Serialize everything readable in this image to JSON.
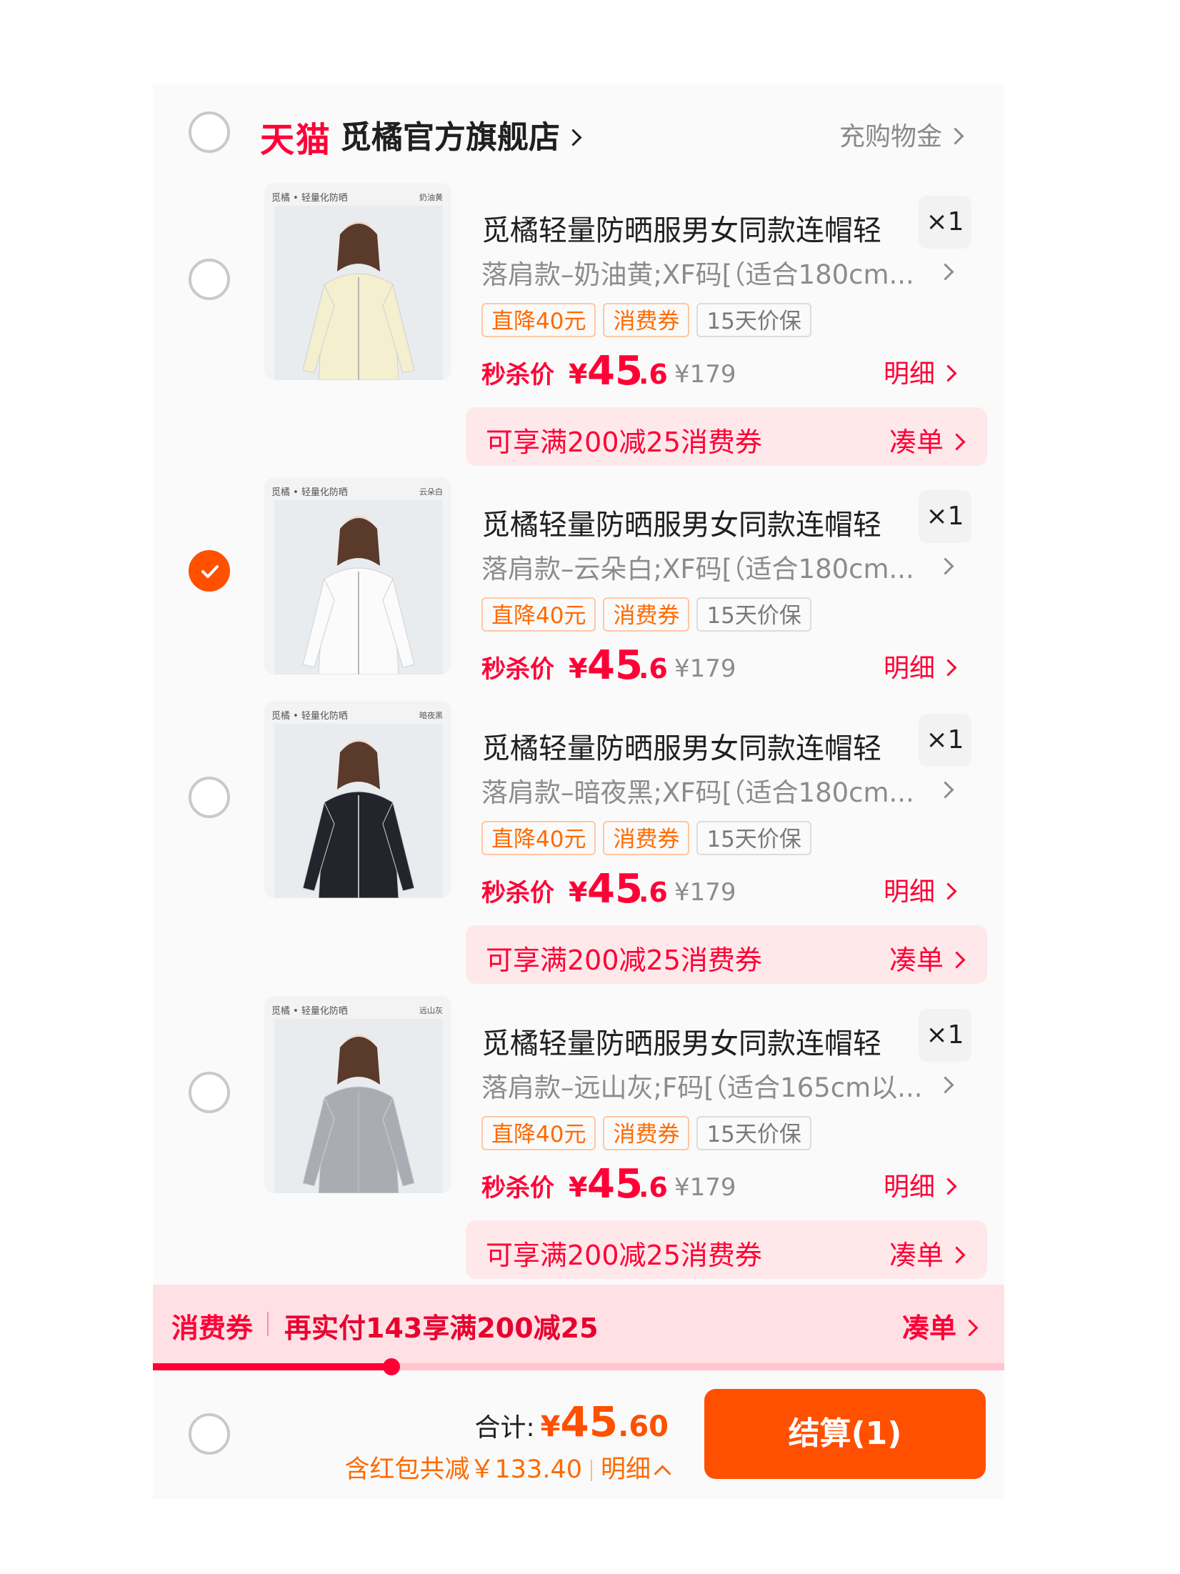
{
  "store": {
    "brand_badge": "天猫",
    "name": "觅橘官方旗舰店",
    "gift_link": "充购物金"
  },
  "items": [
    {
      "checked": false,
      "thumb_caption": "觅橘 • 轻量化防晒",
      "thumb_color_label": "奶油黄",
      "title": "觅橘轻量防晒服男女同款连帽轻",
      "qty": "×1",
      "sku": "落肩款–奶油黄;XF码[（适合180cm...",
      "tags": [
        "直降40元",
        "消费券",
        "15天价保"
      ],
      "price_label": "秒杀价",
      "price_currency": "¥",
      "price_int": "45",
      "price_dec": ".6",
      "original_price": "¥179",
      "detail": "明细",
      "promo": "可享满200减25消费券",
      "promo_action": "凑单",
      "jacket_color": "#f3efcf"
    },
    {
      "checked": true,
      "thumb_caption": "觅橘 • 轻量化防晒",
      "thumb_color_label": "云朵白",
      "title": "觅橘轻量防晒服男女同款连帽轻",
      "qty": "×1",
      "sku": "落肩款–云朵白;XF码[（适合180cm...",
      "tags": [
        "直降40元",
        "消费券",
        "15天价保"
      ],
      "price_label": "秒杀价",
      "price_currency": "¥",
      "price_int": "45",
      "price_dec": ".6",
      "original_price": "¥179",
      "detail": "明细",
      "promo": "",
      "promo_action": "",
      "jacket_color": "#fbfbfb"
    },
    {
      "checked": false,
      "thumb_caption": "觅橘 • 轻量化防晒",
      "thumb_color_label": "暗夜黑",
      "title": "觅橘轻量防晒服男女同款连帽轻",
      "qty": "×1",
      "sku": "落肩款–暗夜黑;XF码[（适合180cm...",
      "tags": [
        "直降40元",
        "消费券",
        "15天价保"
      ],
      "price_label": "秒杀价",
      "price_currency": "¥",
      "price_int": "45",
      "price_dec": ".6",
      "original_price": "¥179",
      "detail": "明细",
      "promo": "可享满200减25消费券",
      "promo_action": "凑单",
      "jacket_color": "#22252c"
    },
    {
      "checked": false,
      "thumb_caption": "觅橘 • 轻量化防晒",
      "thumb_color_label": "远山灰",
      "title": "觅橘轻量防晒服男女同款连帽轻",
      "qty": "×1",
      "sku": "落肩款–远山灰;F码[（适合165cm以...",
      "tags": [
        "直降40元",
        "消费券",
        "15天价保"
      ],
      "price_label": "秒杀价",
      "price_currency": "¥",
      "price_int": "45",
      "price_dec": ".6",
      "original_price": "¥179",
      "detail": "明细",
      "promo": "可享满200减25消费券",
      "promo_action": "凑单",
      "jacket_color": "#a9adb3"
    }
  ],
  "voucher_bar": {
    "label": "消费券",
    "text": "再实付143享满200减25",
    "action": "凑单",
    "progress": 0.28
  },
  "footer": {
    "total_label": "合计:",
    "total_currency": "¥",
    "total_int": "45",
    "total_dec": ".60",
    "saving_text": "含红包共减￥133.40",
    "detail_label": "明细",
    "checkout_label": "结算(1)",
    "select_all_checked": false
  },
  "colors": {
    "accent_red": "#ff0036",
    "accent_orange": "#ff5000"
  }
}
